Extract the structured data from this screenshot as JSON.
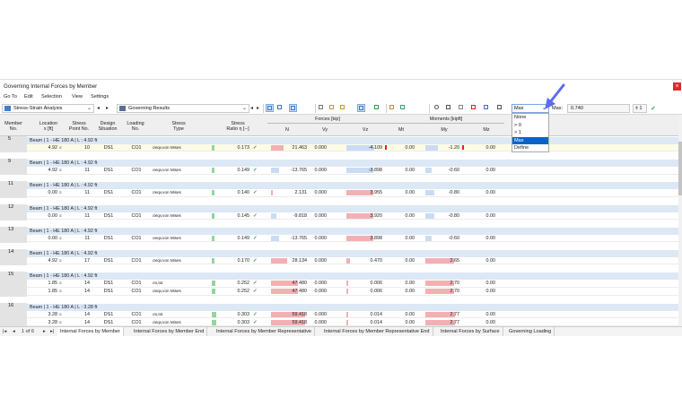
{
  "window": {
    "title": "Governing Internal Forces by Member",
    "close_glyph": "×"
  },
  "menu": [
    "Go To",
    "Edit",
    "Selection",
    "View",
    "Settings"
  ],
  "toolbar": {
    "analysis": "Stress-Strain Analysis",
    "results": "Governing Results",
    "filter_selected": "Max",
    "filter_label": "Max:",
    "filter_value": "0.740",
    "pm_label": "± 1",
    "ok_icon": "check-icon",
    "nav_prev": "◂",
    "nav_next": "▸"
  },
  "dropdown": {
    "options": [
      "None",
      "> 0",
      "> 1",
      "Max",
      "Define"
    ],
    "selected_index": 3
  },
  "columns": {
    "member": "Member\nNo.",
    "location": "Location\nx [ft]",
    "stress_point": "Stress\nPoint No.",
    "design": "Design\nSituation",
    "loading": "Loading\nNo.",
    "stress_type": "Stress\nType",
    "ratio": "Stress\nRatio η [--]",
    "forces_group": "Forces [kip]",
    "moments_group": "Moments [kipft]",
    "N": "N",
    "Vy": "Vy",
    "Vz": "Vz",
    "Mt": "Mt",
    "My": "My",
    "Mz": "Mz"
  },
  "sections": [
    {
      "member": "5",
      "desc": "Beam | 1 - HE 180 A | L : 4.92 ft",
      "rows": [
        {
          "x": "4.92",
          "sp": "10",
          "ds": "DS1",
          "lo": "CO1",
          "type": "σeqv,von Mises",
          "ratio": "0.173",
          "ratio_frac": 0.173,
          "N": "21.463",
          "Vy": "0.000",
          "Vz": "-4.109",
          "Mt": "0.00",
          "My": "-1.20",
          "Mz": "0.00",
          "hl": true,
          "n_mark": false,
          "vz_mark": true,
          "my_mark": true
        }
      ]
    },
    {
      "member": "9",
      "desc": "Beam | 1 - HE 180 A | L : 4.92 ft",
      "rows": [
        {
          "x": "4.92",
          "sp": "11",
          "ds": "DS1",
          "lo": "CO1",
          "type": "σeqv,von Mises",
          "ratio": "0.149",
          "ratio_frac": 0.149,
          "N": "-13.765",
          "Vy": "0.000",
          "Vz": "-3.898",
          "Mt": "0.00",
          "My": "-0.60",
          "Mz": "0.00"
        }
      ]
    },
    {
      "member": "11",
      "desc": "Beam | 1 - HE 180 A | L : 4.92 ft",
      "rows": [
        {
          "x": "0.00",
          "sp": "11",
          "ds": "DS1",
          "lo": "CO1",
          "type": "σeqv,von Mises",
          "ratio": "0.140",
          "ratio_frac": 0.14,
          "N": "2.131",
          "Vy": "0.000",
          "Vz": "3.955",
          "Mt": "0.00",
          "My": "-0.80",
          "Mz": "0.00"
        }
      ]
    },
    {
      "member": "12",
      "desc": "Beam | 1 - HE 180 A | L : 4.92 ft",
      "rows": [
        {
          "x": "0.00",
          "sp": "11",
          "ds": "DS1",
          "lo": "CO1",
          "type": "σeqv,von Mises",
          "ratio": "0.145",
          "ratio_frac": 0.145,
          "N": "-9.818",
          "Vy": "0.000",
          "Vz": "3.920",
          "Mt": "0.00",
          "My": "-0.80",
          "Mz": "0.00"
        }
      ]
    },
    {
      "member": "13",
      "desc": "Beam | 1 - HE 180 A | L : 4.92 ft",
      "rows": [
        {
          "x": "0.00",
          "sp": "11",
          "ds": "DS1",
          "lo": "CO1",
          "type": "σeqv,von Mises",
          "ratio": "0.149",
          "ratio_frac": 0.149,
          "N": "-13.765",
          "Vy": "0.000",
          "Vz": "3.898",
          "Mt": "0.00",
          "My": "-0.60",
          "Mz": "0.00"
        }
      ]
    },
    {
      "member": "14",
      "desc": "Beam | 1 - HE 180 A | L : 4.92 ft",
      "rows": [
        {
          "x": "4.92",
          "sp": "17",
          "ds": "DS1",
          "lo": "CO1",
          "type": "σeqv,von Mises",
          "ratio": "0.170",
          "ratio_frac": 0.17,
          "N": "28.134",
          "Vy": "0.000",
          "Vz": "0.470",
          "Mt": "0.00",
          "My": "2.65",
          "Mz": "0.00"
        }
      ]
    },
    {
      "member": "15",
      "desc": "Beam | 1 - HE 180 A | L : 4.92 ft",
      "rows": [
        {
          "x": "1.85",
          "sp": "14",
          "ds": "DS1",
          "lo": "CO1",
          "type": "σx,tot",
          "ratio": "0.252",
          "ratio_frac": 0.252,
          "N": "47.480",
          "Vy": "0.000",
          "Vz": "0.006",
          "Mt": "0.00",
          "My": "2.70",
          "Mz": "0.00"
        },
        {
          "x": "1.85",
          "sp": "14",
          "ds": "DS1",
          "lo": "CO1",
          "type": "σeqv,von Mises",
          "ratio": "0.252",
          "ratio_frac": 0.252,
          "N": "47.480",
          "Vy": "0.000",
          "Vz": "0.006",
          "Mt": "0.00",
          "My": "2.70",
          "Mz": "0.00"
        }
      ]
    },
    {
      "member": "16",
      "desc": "Beam | 1 - HE 180 A | L : 3.28 ft",
      "rows": [
        {
          "x": "3.28",
          "sp": "14",
          "ds": "DS1",
          "lo": "CO1",
          "type": "σx,tot",
          "ratio": "0.303",
          "ratio_frac": 0.303,
          "N": "59.418",
          "Vy": "0.000",
          "Vz": "0.014",
          "Mt": "0.00",
          "My": "2.77",
          "Mz": "0.00"
        },
        {
          "x": "3.28",
          "sp": "14",
          "ds": "DS1",
          "lo": "CO1",
          "type": "σeqv,von Mises",
          "ratio": "0.303",
          "ratio_frac": 0.303,
          "N": "59.418",
          "Vy": "0.000",
          "Vz": "0.014",
          "Mt": "0.00",
          "My": "2.77",
          "Mz": "0.00"
        }
      ]
    }
  ],
  "pager": {
    "first": "|◂",
    "prev": "◂",
    "text": "1 of 6",
    "next": "▸",
    "last": "▸|"
  },
  "tabs": [
    "Internal Forces by Member",
    "Internal Forces by Member End",
    "Internal Forces by Member Representative",
    "Internal Forces by Member Representative End",
    "Internal Forces by Surface",
    "Governing Loading"
  ],
  "colors": {
    "accent": "#0a64c8",
    "section_bg": "#dde8f5",
    "pos_bar": "#f3b0b3",
    "neg_bar": "#c9dcf3",
    "ratio_bar": "#8fd79f",
    "arrow": "#5b6cf0"
  }
}
